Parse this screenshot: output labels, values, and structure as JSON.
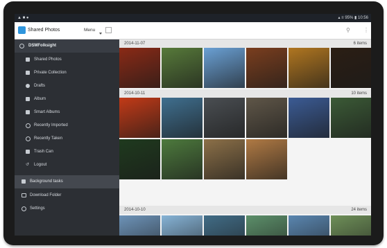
{
  "statusbar": {
    "left_icons": "▲ ■ ●",
    "right": "▴ ≡ 95% ▮ 10:56"
  },
  "actionbar": {
    "title": "Shared Photos",
    "menu_label": "Menu"
  },
  "sidebar": {
    "header": "DSMFolksight",
    "items": [
      {
        "label": "Shared Photos"
      },
      {
        "label": "Private Collection"
      },
      {
        "label": "Drafts"
      },
      {
        "label": "Album"
      },
      {
        "label": "Smart Albums"
      },
      {
        "label": "Recently Imported"
      },
      {
        "label": "Recently Taken"
      },
      {
        "label": "Trash Can"
      },
      {
        "label": "Logout"
      }
    ],
    "sections": [
      {
        "label": "Background tasks"
      },
      {
        "label": "Download Folder"
      },
      {
        "label": "Settings"
      }
    ]
  },
  "groups": [
    {
      "date": "2014-11-07",
      "count": "6 items",
      "colors": [
        "#8a2a16",
        "#577a3a",
        "#6aa0d4",
        "#7a3e1e",
        "#b07620",
        "#2b1e14"
      ]
    },
    {
      "date": "2014-10-11",
      "count": "10 items",
      "colors": [
        "#c23a17",
        "#3f6f8f",
        "#4a4e52",
        "#5f5648",
        "#3b5b94",
        "#3b5a36",
        "#1f3a1e",
        "#4d7a3d",
        "#8c7048",
        "#b07a44"
      ]
    },
    {
      "date": "2014-10-10",
      "count": "24 items",
      "colors": [
        "#6d93b8",
        "#86b3d6",
        "#416c86",
        "#5c8f6a",
        "#5a86b0",
        "#6e8f58"
      ]
    }
  ]
}
